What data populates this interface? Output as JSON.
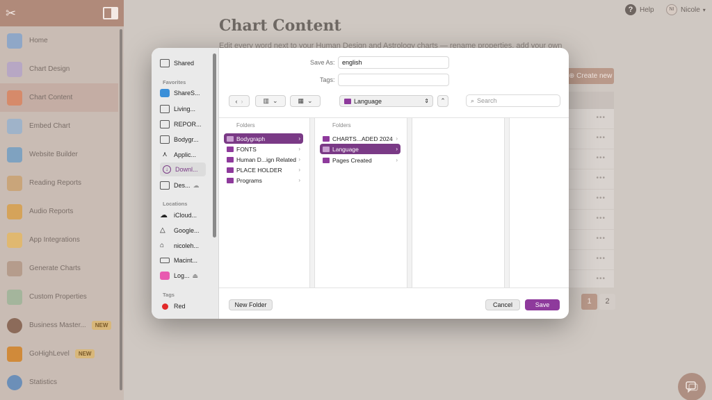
{
  "sidebar": {
    "items": [
      {
        "label": "Home",
        "color": "#8fa7c7",
        "badge": ""
      },
      {
        "label": "Chart Design",
        "color": "#b7a7c4",
        "badge": ""
      },
      {
        "label": "Chart Content",
        "color": "#d68a6a",
        "badge": ""
      },
      {
        "label": "Embed Chart",
        "color": "#9fb3c9",
        "badge": ""
      },
      {
        "label": "Website Builder",
        "color": "#7fa2c0",
        "badge": ""
      },
      {
        "label": "Reading Reports",
        "color": "#c9a57a",
        "badge": ""
      },
      {
        "label": "Audio Reports",
        "color": "#d5a35a",
        "badge": ""
      },
      {
        "label": "App Integrations",
        "color": "#e0b870",
        "badge": ""
      },
      {
        "label": "Generate Charts",
        "color": "#b59c8c",
        "badge": ""
      },
      {
        "label": "Custom Properties",
        "color": "#a4b59c",
        "badge": ""
      },
      {
        "label": "Business Master...",
        "color": "#8c6b5a",
        "badge": "NEW"
      },
      {
        "label": "GoHighLevel",
        "color": "#d08a3a",
        "badge": "NEW"
      },
      {
        "label": "Statistics",
        "color": "#6c8fb8",
        "badge": ""
      }
    ]
  },
  "topbar": {
    "help_label": "Help",
    "user_initials": "NI",
    "user_name": "Nicole"
  },
  "main": {
    "title": "Chart Content",
    "subtitle": "Edit every word next to your Human Design and Astrology charts — rename properties, add your own",
    "create_label": "Create new",
    "pages": [
      "1",
      "2"
    ]
  },
  "dialog": {
    "save_as_label": "Save As:",
    "save_as_value": "english",
    "tags_label": "Tags:",
    "location": "Language",
    "search_placeholder": "Search",
    "sidebar": {
      "shared": "Shared",
      "favorites_header": "Favorites",
      "favorites": [
        "ShareS...",
        "Living...",
        "REPOR...",
        "Bodygr...",
        "Applic...",
        "Downl...",
        "Des..."
      ],
      "locations_header": "Locations",
      "locations": [
        "iCloud...",
        "Google...",
        "nicoleh...",
        "Macint...",
        "Log..."
      ],
      "tags_header": "Tags",
      "tags": [
        "Red"
      ]
    },
    "column1": {
      "header": "Folders",
      "items": [
        "Bodygraph",
        "FONTS",
        "Human D...ign Related",
        "PLACE HOLDER",
        "Programs"
      ],
      "selected": "Bodygraph"
    },
    "column2": {
      "header": "Folders",
      "items": [
        "CHARTS...ADED 2024",
        "Language",
        "Pages Created"
      ],
      "selected": "Language"
    },
    "buttons": {
      "new_folder": "New Folder",
      "cancel": "Cancel",
      "save": "Save"
    }
  },
  "colors": {
    "accent": "#8e3a9c",
    "brand": "#b08a7a"
  }
}
